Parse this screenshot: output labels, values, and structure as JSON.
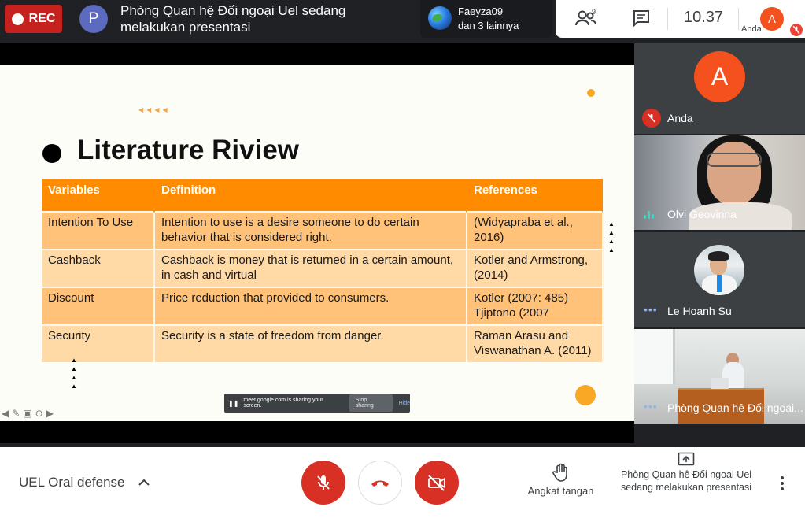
{
  "topbar": {
    "rec_label": "REC",
    "presenter_initial": "P",
    "presenter_text": "Phòng Quan hệ Đối ngoại Uel sedang melakukan presentasi",
    "pinned_name": "Faeyza09",
    "pinned_others": "dan 3 lainnya",
    "people_count": "9",
    "clock": "10.37",
    "self_initial": "A",
    "self_name": "Anda"
  },
  "slide": {
    "title": "Literature Riview",
    "table": {
      "headers": [
        "Variables",
        "Definition",
        "References"
      ],
      "rows": [
        [
          "Intention To Use",
          "Intention to use is a desire someone to do certain behavior that is considered right.",
          "(Widyapraba et al., 2016)"
        ],
        [
          "Cashback",
          "Cashback is money that is returned in a certain amount, in cash and virtual",
          "Kotler and Armstrong, (2014)"
        ],
        [
          "Discount",
          "Price reduction that provided to consumers.",
          "Kotler (2007: 485) Tjiptono (2007"
        ],
        [
          "Security",
          "Security is a state of freedom from danger.",
          "Raman Arasu and Viswanathan A. (2011)"
        ]
      ]
    },
    "share_bar": {
      "message": "meet.google.com is sharing your screen.",
      "stop_label": "Stop sharing",
      "hide_label": "Hide"
    }
  },
  "tiles": [
    {
      "initial": "A",
      "name": "Anda"
    },
    {
      "name": "Olvi Geovinna"
    },
    {
      "name": "Le Hoanh Su"
    },
    {
      "name": "Phòng Quan hệ Đối ngoại..."
    }
  ],
  "bottombar": {
    "meeting_name": "UEL Oral defense",
    "raise_hand_label": "Angkat tangan",
    "presenting_label": "Phòng Quan hệ Đối ngoại Uel sedang melakukan presentasi"
  },
  "colors": {
    "accent_red": "#d93025",
    "table_header": "#ff8c00",
    "table_row_dark": "#ffc278",
    "table_row_light": "#ffd9a6",
    "avatar_orange": "#f4511e"
  }
}
